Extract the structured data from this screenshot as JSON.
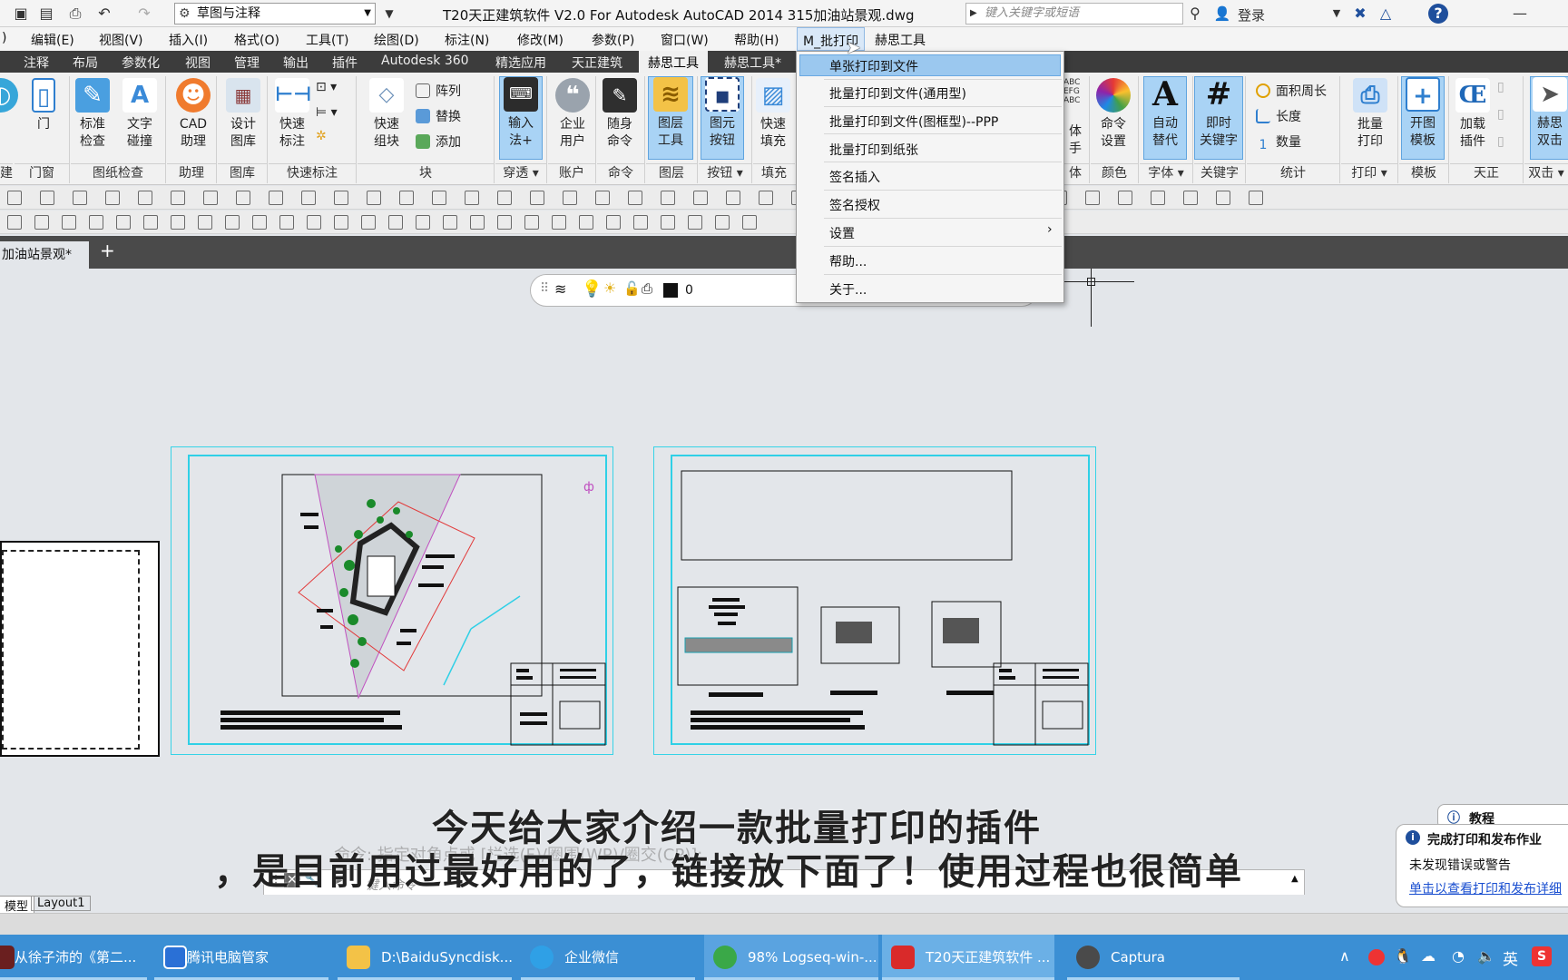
{
  "titlebar": {
    "workspace": "草图与注释",
    "title": "T20天正建筑软件 V2.0 For Autodesk AutoCAD 2014    315加油站景观.dwg",
    "search_placeholder": "键入关键字或短语",
    "login": "登录"
  },
  "menubar": [
    "编辑(E)",
    "视图(V)",
    "插入(I)",
    "格式(O)",
    "工具(T)",
    "绘图(D)",
    "标注(N)",
    "修改(M)",
    "参数(P)",
    "窗口(W)",
    "帮助(H)",
    "M_批打印",
    "赫思工具"
  ],
  "ribbon_tabs": [
    "注释",
    "布局",
    "参数化",
    "视图",
    "管理",
    "输出",
    "插件",
    "Autodesk 360",
    "精选应用",
    "天正建筑",
    "赫思工具",
    "赫思工具*"
  ],
  "ribbon_active_tab": "赫思工具",
  "ribbon_buttons": [
    {
      "label": "门",
      "group": "门窗"
    },
    {
      "label": "标准\n检查",
      "group": "图纸检查"
    },
    {
      "label": "文字\n碰撞",
      "group": "图纸检查"
    },
    {
      "label": "CAD\n助理",
      "group": "助理"
    },
    {
      "label": "设计\n图库",
      "group": "图库"
    },
    {
      "label": "快速\n标注",
      "group": "快速标注"
    },
    {
      "label": "快速\n组块",
      "group": "块"
    },
    {
      "label": "输入\n法+",
      "group": "穿透"
    },
    {
      "label": "企业\n用户",
      "group": "账户"
    },
    {
      "label": "随身\n命令",
      "group": "命令"
    },
    {
      "label": "图层\n工具",
      "group": "图层"
    },
    {
      "label": "图元\n按钮",
      "group": "按钮"
    },
    {
      "label": "快速\n填充",
      "group": "填充"
    },
    {
      "label": "命令\n设置",
      "group": "颜色"
    },
    {
      "label": "自动\n替代",
      "group": "字体"
    },
    {
      "label": "即时\n关键字",
      "group": "关键字"
    },
    {
      "label": "批量\n打印",
      "group": "打印"
    },
    {
      "label": "开图\n模板",
      "group": "模板"
    },
    {
      "label": "加载\n插件",
      "group": "天正"
    },
    {
      "label": "赫思\n双击",
      "group": "双击"
    }
  ],
  "ribbon_small": {
    "block": [
      "阵列",
      "替换",
      "添加"
    ],
    "stats": [
      "面积周长",
      "长度",
      "数量"
    ]
  },
  "ribbon_groups": [
    "门窗",
    "图纸检查",
    "助理",
    "图库",
    "快速标注",
    "块",
    "穿透",
    "账户",
    "命令",
    "图层",
    "按钮",
    "填充",
    "体",
    "颜色",
    "字体",
    "关键字",
    "统计",
    "打印",
    "模板",
    "天正",
    "双击"
  ],
  "doc_tab": "加油站景观*",
  "layer": {
    "current": "0"
  },
  "context_menu": {
    "items": [
      "单张打印到文件",
      "批量打印到文件(通用型)",
      "批量打印到文件(图框型)--PPP",
      "批量打印到纸张",
      "签名插入",
      "签名授权",
      "设置",
      "帮助...",
      "关于..."
    ],
    "highlighted": 0
  },
  "subtitles": [
    "今天给大家介绍一款批量打印的插件",
    "，是目前用过最好用的了，链接放下面了！使用过程也很简单"
  ],
  "command": {
    "placeholder": "键入命令",
    "history": "命令: 指定对角点或 [栏选(F)/圈围(WP)/圈交(CP)]:"
  },
  "layout_tabs": [
    "模型",
    "Layout1"
  ],
  "notification": {
    "header": "教程",
    "title": "完成打印和发布作业",
    "body": "未发现错误或警告",
    "link": "单击以查看打印和发布详细"
  },
  "taskbar": {
    "tasks": [
      "从徐子沛的《第二...",
      "腾讯电脑管家",
      "D:\\BaiduSyncdisk...",
      "企业微信",
      "98% Logseq-win-...",
      "T20天正建筑软件 ...",
      "Captura"
    ],
    "tray": "英"
  }
}
